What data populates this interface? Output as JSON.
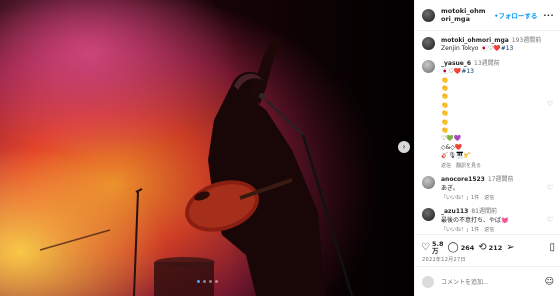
{
  "colors": {
    "accent": "#0095f6",
    "text": "#262626",
    "muted": "#737373",
    "tag": "#00376b"
  },
  "post": {
    "username": "motoki_ohmori_mga",
    "follow_label": "•フォローする",
    "more_icon": "more-horizontal-icon"
  },
  "caption": {
    "username": "motoki_ohmori_mga",
    "time": "193週間前",
    "text": "Zenjin Tokyo 🇯🇵♡❤️",
    "tag": "#13"
  },
  "comments": [
    {
      "username": "_yasue_6",
      "time": "13週間前",
      "text": "🇯🇵♡❤️",
      "tag": "#13",
      "lines": [
        "👏",
        "👏",
        "👏",
        "👏",
        "👏",
        "👏",
        "👏",
        "♡💚💜",
        "◇&◇❤️",
        "🎸🎙🎹🎷"
      ],
      "reply_label": "返信",
      "translate_label": "翻訳を見る"
    },
    {
      "username": "anocore1523",
      "time": "17週間前",
      "text": "あぎ。",
      "likes_label": "「いいね！」1件",
      "reply_label": "返信"
    },
    {
      "username": "_azu113",
      "time": "81週間前",
      "text": "最後の不意打ち、やば💓",
      "likes_label": "「いいね！」1件",
      "reply_label": "返信"
    }
  ],
  "actions": {
    "likes": "5.8\n万",
    "comments": "264",
    "shares": "212"
  },
  "date": "2022年12月27日",
  "add_comment": {
    "placeholder": "コメントを追加..."
  }
}
